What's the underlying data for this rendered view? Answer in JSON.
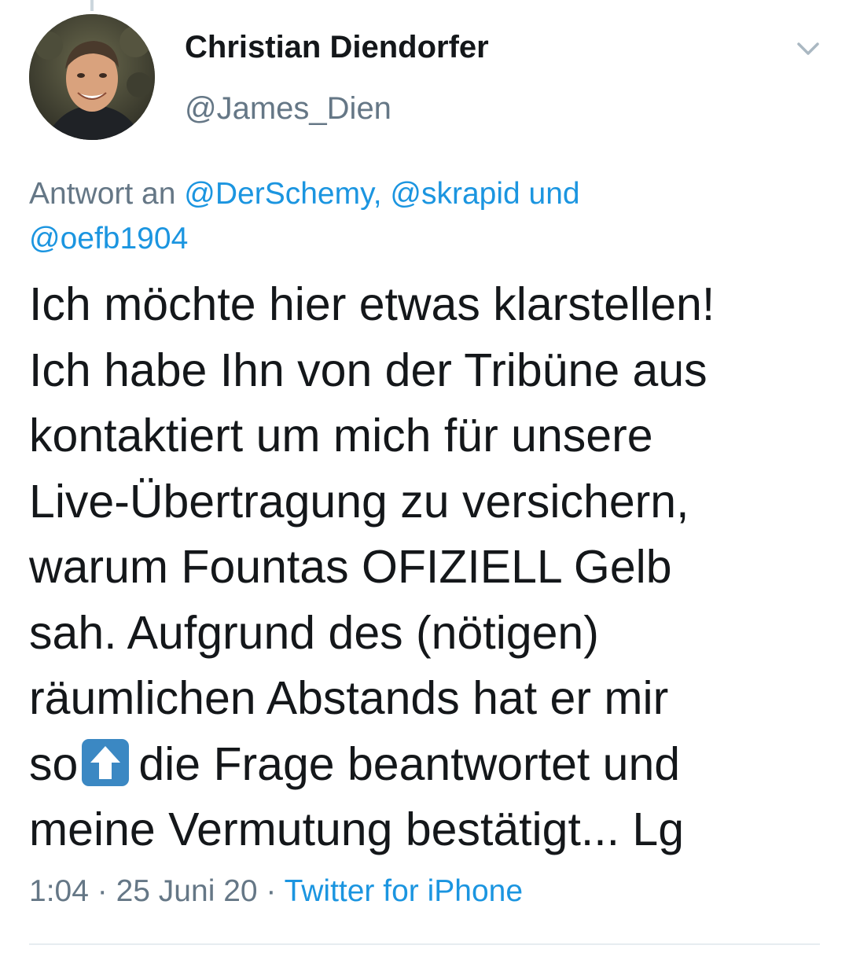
{
  "tweet": {
    "display_name": "Christian Diendorfer",
    "handle": "@James_Dien",
    "reply_prefix": "Antwort an",
    "reply_mentions": [
      "@DerSchemy,",
      "@skrapid",
      "@oefb1904"
    ],
    "reply_conjunction": "und",
    "text_lines": [
      "Ich möchte hier etwas klarstellen!",
      "Ich habe Ihn von der Tribüne aus",
      "kontaktiert um mich für unsere",
      "Live-Übertragung zu versichern,",
      "warum Fountas OFIZIELL Gelb",
      "sah. Aufgrund des (nötigen)",
      "räumlichen Abstands hat er mir",
      "so",
      "die Frage beantwortet und",
      "meine Vermutung bestätigt... Lg"
    ],
    "inline_emoji": "up-arrow-emoji",
    "time": "1:04",
    "separator": "·",
    "date": "25 Juni 20",
    "source": "Twitter for iPhone",
    "menu_icon": "chevron-down-icon"
  },
  "colors": {
    "text": "#14171a",
    "secondary": "#657786",
    "link": "#1b95e0",
    "divider": "#e6ecf0",
    "emoji_blue": "#3b88c3"
  }
}
